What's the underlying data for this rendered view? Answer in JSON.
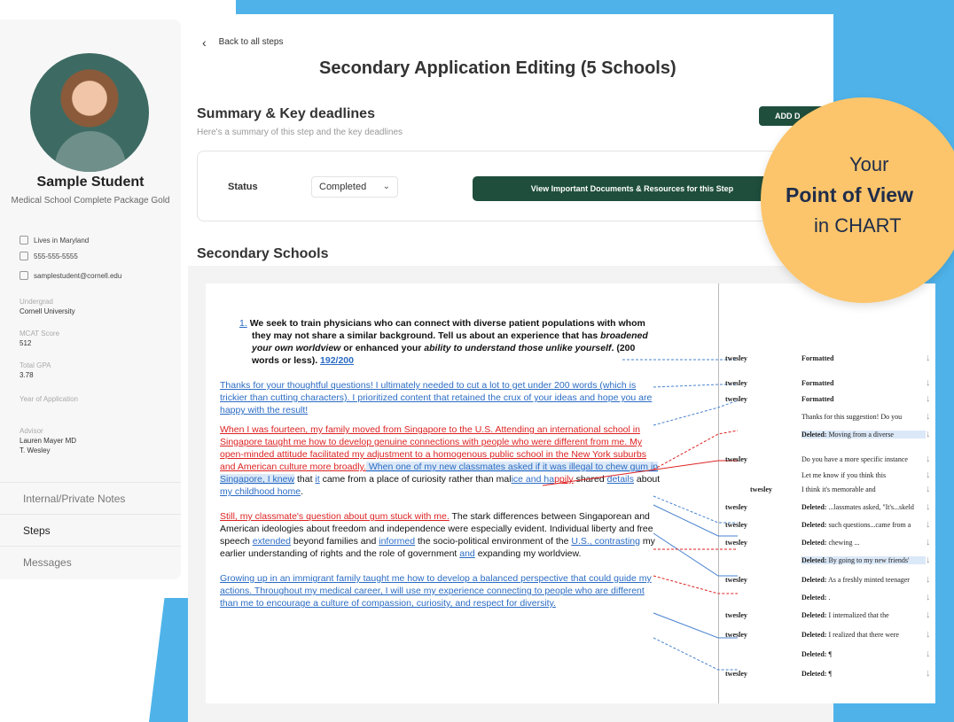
{
  "profile": {
    "name": "Sample Student",
    "package": "Medical School Complete Package Gold",
    "location": "Lives in Maryland",
    "phone": "555-555-5555",
    "email": "samplestudent@cornell.edu",
    "undergrad_label": "Undergrad",
    "undergrad": "Cornell University",
    "mcat_label": "MCAT Score",
    "mcat": "512",
    "gpa_label": "Total GPA",
    "gpa": "3.78",
    "year_label": "Year of Application",
    "advisor_label": "Advisor",
    "advisor_1": "Lauren Mayer MD",
    "advisor_2": "T. Wesley"
  },
  "nav": {
    "notes": "Internal/Private Notes",
    "steps": "Steps",
    "messages": "Messages"
  },
  "header": {
    "back": "Back to all steps",
    "title": "Secondary Application Editing (5 Schools)"
  },
  "summary": {
    "title": "Summary & Key deadlines",
    "subtitle": "Here's a summary of this step and the key deadlines",
    "add_button": "ADD D",
    "status_label": "Status",
    "status_value": "Completed",
    "view_button": "View Important Documents & Resources for this Step"
  },
  "schools": {
    "title": "Secondary Schools"
  },
  "document": {
    "q_num": "1.",
    "q_a": "We seek to train physicians who can connect with diverse patient populations with whom they may not share a similar background. Tell us about an experience that has ",
    "q_b": "broadened your own worldview",
    "q_c": " or enhanced your ",
    "q_d": "ability to understand those unlike yourself",
    "q_e": ". (200 words or less). ",
    "q_count": "192/200",
    "p1": "Thanks for your thoughtful questions! I ultimately needed to cut a lot to get under 200 words (which is trickier than cutting characters). I prioritized content that retained the crux of your ideas and hope you are happy with the result!",
    "p2_red": "When I was fourteen, my family moved from Singapore to the U.S. Attending an international school in Singapore taught me how to develop genuine connections with people who were different from me. My open-minded attitude facilitated my adjustment to a homogenous public school in the New York suburbs and American culture more broadly.",
    "p2_blue": " When one of my new classmates asked if it was illegal to chew gum in Singapore, I knew",
    "p2_a": " that ",
    "p2_it": "it",
    "p2_b": " came from a place of curiosity rather than mal",
    "p2_c": "ice and ha",
    "p2_d": "ppily",
    "p2_e": " shared ",
    "p2_f": "details",
    "p2_g": " about ",
    "p2_h": "my childhood home",
    "p2_i": ".",
    "p3_red": "Still, my classmate's question about gum stuck with me.",
    "p3_a": " The stark differences between Singaporean and American ideologies about freedom and independence were especially evident. Individual liberty and free speech ",
    "p3_b": "extended",
    "p3_c": " beyond families and ",
    "p3_d": "informed",
    "p3_e": " the socio-political environment of the ",
    "p3_f": "U.S., contrasting",
    "p3_g": " my earlier understanding of rights and the role of government ",
    "p3_h": "and",
    "p3_i": " expanding my worldview.",
    "p4": "Growing up in an immigrant family taught me how to develop a balanced perspective that could guide my actions. Throughout my medical career, I will use my experience connecting to people who are different than me to encourage a culture of compassion, curiosity, and respect for diversity."
  },
  "comments": [
    {
      "author": "twesley",
      "label": "",
      "text": "Formatted",
      "bold": true
    },
    {
      "author": "twesley",
      "label": "",
      "text": "Formatted",
      "bold": true
    },
    {
      "author": "twesley",
      "label": "",
      "text": "Formatted",
      "bold": true
    },
    {
      "author": "",
      "label": "",
      "text": "Thanks for this suggestion! Do you",
      "bold": false
    },
    {
      "author": "",
      "label": "Deleted:",
      "text": " Moving from a diverse",
      "bold": false
    },
    {
      "author": "twesley",
      "label": "",
      "text": "Do you have a more specific instance",
      "bold": false
    },
    {
      "author": "",
      "label": "",
      "text": "Let me know if you think this",
      "bold": false
    },
    {
      "author": "twesley",
      "label": "",
      "text": "I think it's memorable and",
      "bold": false
    },
    {
      "author": "twesley",
      "label": "Deleted:",
      "text": " ...lassmates asked, \"It's...skeld",
      "bold": false
    },
    {
      "author": "twesley",
      "label": "Deleted:",
      "text": " such questions...came from a",
      "bold": false
    },
    {
      "author": "twesley",
      "label": "Deleted:",
      "text": " chewing ...",
      "bold": false
    },
    {
      "author": "",
      "label": "Deleted:",
      "text": " By going to my new friends'",
      "bold": false
    },
    {
      "author": "twesley",
      "label": "Deleted:",
      "text": " As a freshly minted teenager",
      "bold": false
    },
    {
      "author": "",
      "label": "Deleted:",
      "text": " .",
      "bold": false
    },
    {
      "author": "twesley",
      "label": "Deleted:",
      "text": " I internalized that the",
      "bold": false
    },
    {
      "author": "twesley",
      "label": "Deleted:",
      "text": " I realized that there were",
      "bold": false
    },
    {
      "author": "",
      "label": "Deleted:",
      "text": " ¶",
      "bold": false
    },
    {
      "author": "twesley",
      "label": "Deleted:",
      "text": " ¶",
      "bold": false
    }
  ],
  "overlay": {
    "line1": "Your",
    "line2": "Point of View",
    "line3": "in CHART"
  }
}
